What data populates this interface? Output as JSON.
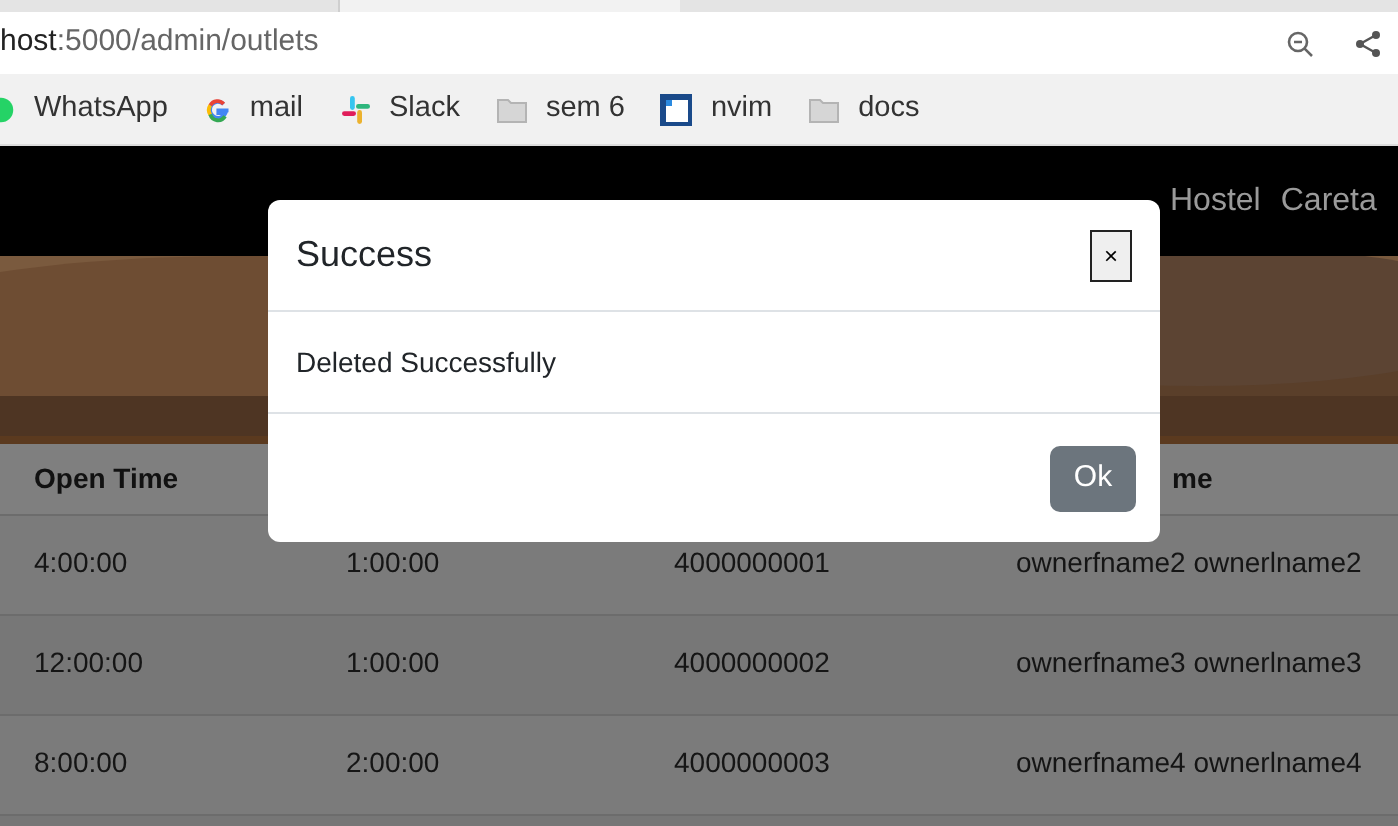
{
  "browser": {
    "url_host": "host",
    "url_path": ":5000/admin/outlets",
    "bookmarks": [
      {
        "kind": "whatsapp",
        "label": "WhatsApp"
      },
      {
        "kind": "google",
        "label": "mail"
      },
      {
        "kind": "slack",
        "label": "Slack"
      },
      {
        "kind": "folder",
        "label": "sem 6"
      },
      {
        "kind": "nvim",
        "label": "nvim"
      },
      {
        "kind": "folder",
        "label": "docs"
      }
    ]
  },
  "navbar": {
    "items": [
      "Hostel",
      "Careta"
    ]
  },
  "table": {
    "columns": [
      "Open Time",
      "",
      "",
      "me"
    ],
    "rows": [
      [
        "4:00:00",
        "1:00:00",
        "4000000001",
        "ownerfname2 ownerlname2"
      ],
      [
        "12:00:00",
        "1:00:00",
        "4000000002",
        "ownerfname3 ownerlname3"
      ],
      [
        "8:00:00",
        "2:00:00",
        "4000000003",
        "ownerfname4 ownerlname4"
      ]
    ]
  },
  "modal": {
    "title": "Success",
    "close": "×",
    "message": "Deleted Successfully",
    "button": "Ok"
  }
}
